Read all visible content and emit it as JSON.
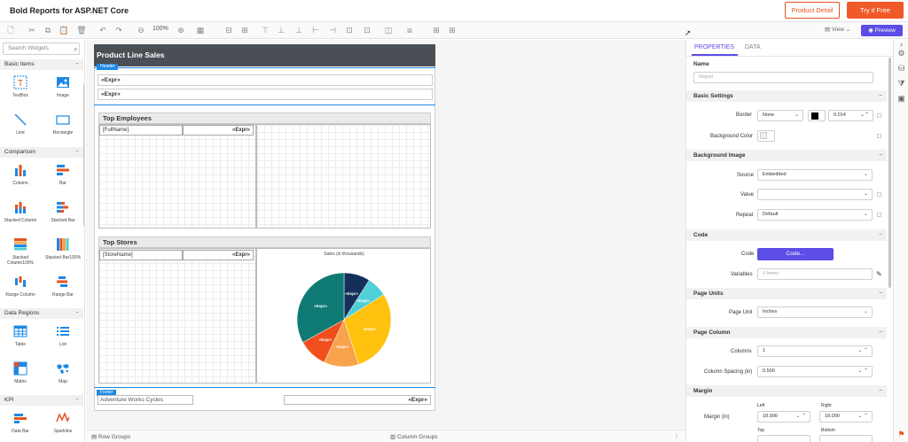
{
  "app": {
    "title": "Bold Reports for ASP.NET Core",
    "product_detail": "Product Detail",
    "try_free": "Try it Free"
  },
  "toolbar": {
    "zoom": "100%",
    "view": "View",
    "preview": "Preview"
  },
  "widgets": {
    "search_placeholder": "Search Widgets",
    "categories": {
      "basic": "Basic Items",
      "comparison": "Comparison",
      "data_regions": "Data Regions",
      "kpi": "KPI"
    },
    "items": {
      "textbox": "TextBox",
      "image": "Image",
      "line": "Line",
      "rectangle": "Rectangle",
      "column": "Column",
      "bar": "Bar",
      "stacked_column": "Stacked Column",
      "stacked_bar": "Stacked Bar",
      "stacked_column100": "Stacked Column100%",
      "stacked_bar100": "Stacked Bar100%",
      "range_column": "Range Column",
      "range_bar": "Range Bar",
      "table": "Table",
      "list": "List",
      "matrix": "Matrix",
      "map": "Map",
      "data_bar": "Data Bar",
      "sparkline": "Sparkline"
    }
  },
  "report": {
    "title": "Product Line Sales",
    "header_tag": "Header",
    "footer_tag": "Footer",
    "expr": "«Expr»",
    "top_employees": "Top Employees",
    "fullname": "[FullName]",
    "top_stores": "Top Stores",
    "storename": "[StoreName]",
    "chart_title": "Sales (in thousands)",
    "footer_left": "Adventure Works Cycles"
  },
  "pie": {
    "slices": [
      {
        "value": 9,
        "color": "#14305a"
      },
      {
        "value": 7,
        "color": "#4fd0d6"
      },
      {
        "value": 29,
        "color": "#ffc20e"
      },
      {
        "value": 12,
        "color": "#f8a34c"
      },
      {
        "value": 10,
        "color": "#f04e1d"
      },
      {
        "value": 33,
        "color": "#0f7a74"
      }
    ]
  },
  "bottom": {
    "row_groups": "Row Groups",
    "column_groups": "Column Groups"
  },
  "properties": {
    "tab_properties": "PROPERTIES",
    "tab_data": "DATA",
    "name_label": "Name",
    "name_placeholder": "Report",
    "basic_settings": "Basic Settings",
    "border_label": "Border",
    "border_value": "None",
    "border_width": "0.014",
    "background_color_label": "Background Color",
    "background_image": "Background Image",
    "source_label": "Source",
    "source_value": "Embedded",
    "value_label": "Value",
    "repeat_label": "Repeat",
    "repeat_value": "Default",
    "code_section": "Code",
    "code_label": "Code",
    "code_button": "Code...",
    "variables_label": "Variables",
    "variables_value": "0 Items",
    "page_units": "Page Units",
    "page_unit_label": "Page Unit",
    "page_unit_value": "Inches",
    "page_column": "Page Column",
    "columns_label": "Columns",
    "columns_value": "1",
    "column_spacing_label": "Column Spacing (in)",
    "column_spacing_value": "0.500",
    "margin": "Margin",
    "left_label": "Left",
    "right_label": "Right",
    "margin_label": "Margin (in)",
    "margin_left": "18.000",
    "margin_right": "18.000",
    "top_label": "Top",
    "bottom_label": "Bottom"
  },
  "colors": {
    "accent": "#5b4de6",
    "brand": "#f05a28",
    "header_blue": "#1e88e5",
    "title_bar": "#4a4f55"
  }
}
